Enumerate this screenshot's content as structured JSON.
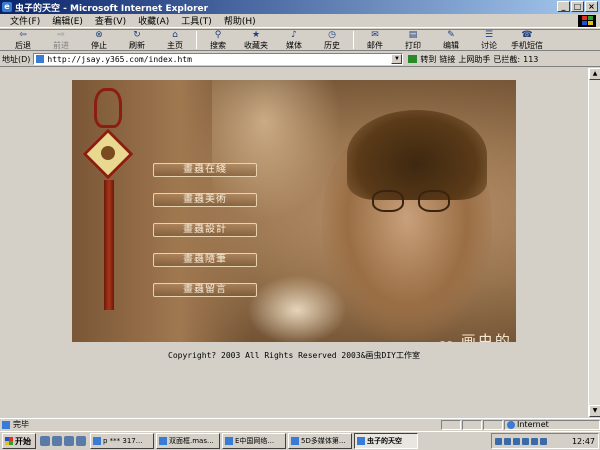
{
  "window": {
    "title": "虫子的天空 - Microsoft Internet Explorer",
    "min_glyph": "_",
    "max_glyph": "□",
    "close_glyph": "×"
  },
  "menubar": {
    "items": [
      "文件(F)",
      "编辑(E)",
      "查看(V)",
      "收藏(A)",
      "工具(T)",
      "帮助(H)"
    ]
  },
  "toolbar": {
    "back": "后退",
    "forward": "前进",
    "stop": "停止",
    "refresh": "刷新",
    "home": "主页",
    "search": "搜索",
    "favorites": "收藏夹",
    "media": "媒体",
    "history": "历史",
    "mail": "邮件",
    "print": "打印",
    "edit": "编辑",
    "discuss": "讨论",
    "sms": "手机短信"
  },
  "addressbar": {
    "label": "地址(D)",
    "url": "http://jsay.y365.com/index.htm",
    "go": "转到",
    "links": "链接",
    "online_helper": "上网助手",
    "blocked_label": "已拦截:",
    "blocked_count": "113"
  },
  "page": {
    "menu": [
      "畫蟲在綫",
      "畫蟲美術",
      "畫蟲設計",
      "畫蟲隨筆",
      "畫蟲留言"
    ],
    "site_title": "-- 画虫的天空 --",
    "copyright": "Copyright? 2003 All Rights Reserved 2003&画虫DIY工作室"
  },
  "statusbar": {
    "status": "完毕",
    "zone": "Internet"
  },
  "taskbar": {
    "start": "开始",
    "tasks": [
      "p *** 317...",
      "双面框.mas...",
      "E中国网络...",
      "5D多媒体第...",
      "虫子的天空"
    ],
    "active_index": 4,
    "clock": "12:47"
  }
}
